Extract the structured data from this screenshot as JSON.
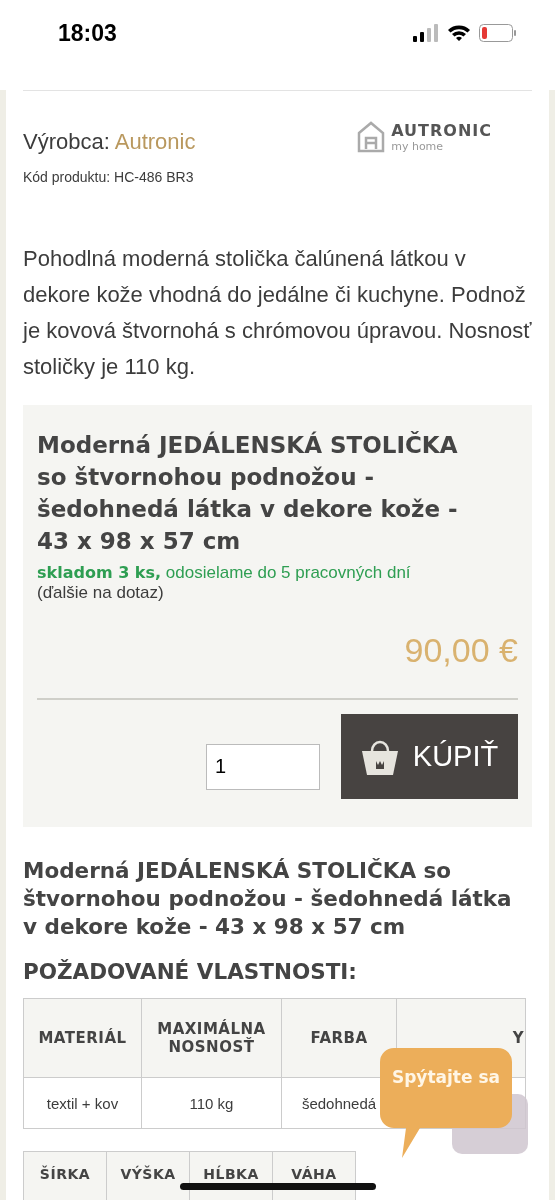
{
  "status_bar": {
    "time": "18:03"
  },
  "manufacturer": {
    "label": "Výrobca:",
    "name": "Autronic"
  },
  "logo": {
    "brand": "AUTRONIC",
    "tagline": "my home"
  },
  "product_code": "Kód produktu: HC-486 BR3",
  "description": "Pohodlná moderná stolička čalúnená látkou v dekore kože vhodná do jedálne či kuchyne. Podnož je kovová štvornohá s chrómovou úpravou. Nosnosť stoličky je 110 kg.",
  "buy_box": {
    "title": "Moderná JEDÁLENSKÁ STOLIČKA so štvornohou podnožou - šedohnedá látka v dekore kože - 43 x 98 x 57 cm",
    "stock": "skladom 3 ks,",
    "shipping": "odosielame do 5 pracovných dní",
    "note": "(ďalšie na dotaz)",
    "price": "90,00 €",
    "quantity": "1",
    "buy_button": "KÚPIŤ"
  },
  "product_heading": "Moderná JEDÁLENSKÁ STOLIČKA so štvornohou podnožou - šedohnedá látka v dekore kože - 43 x 98 x 57 cm",
  "properties_heading": "POŽADOVANÉ VLASTNOSTI:",
  "properties_table": {
    "columns": [
      "MATERIÁL",
      "MAXIMÁLNA NOSNOSŤ",
      "FARBA",
      "Y"
    ],
    "rows": [
      [
        "textil + kov",
        "110 kg",
        "šedohnedá"
      ]
    ]
  },
  "dimensions_table": {
    "columns": [
      "ŠÍRKA",
      "VÝŠKA",
      "HĹBKA",
      "VÁHA"
    ]
  },
  "chat_bubble": {
    "label": "Spýtajte sa"
  }
}
